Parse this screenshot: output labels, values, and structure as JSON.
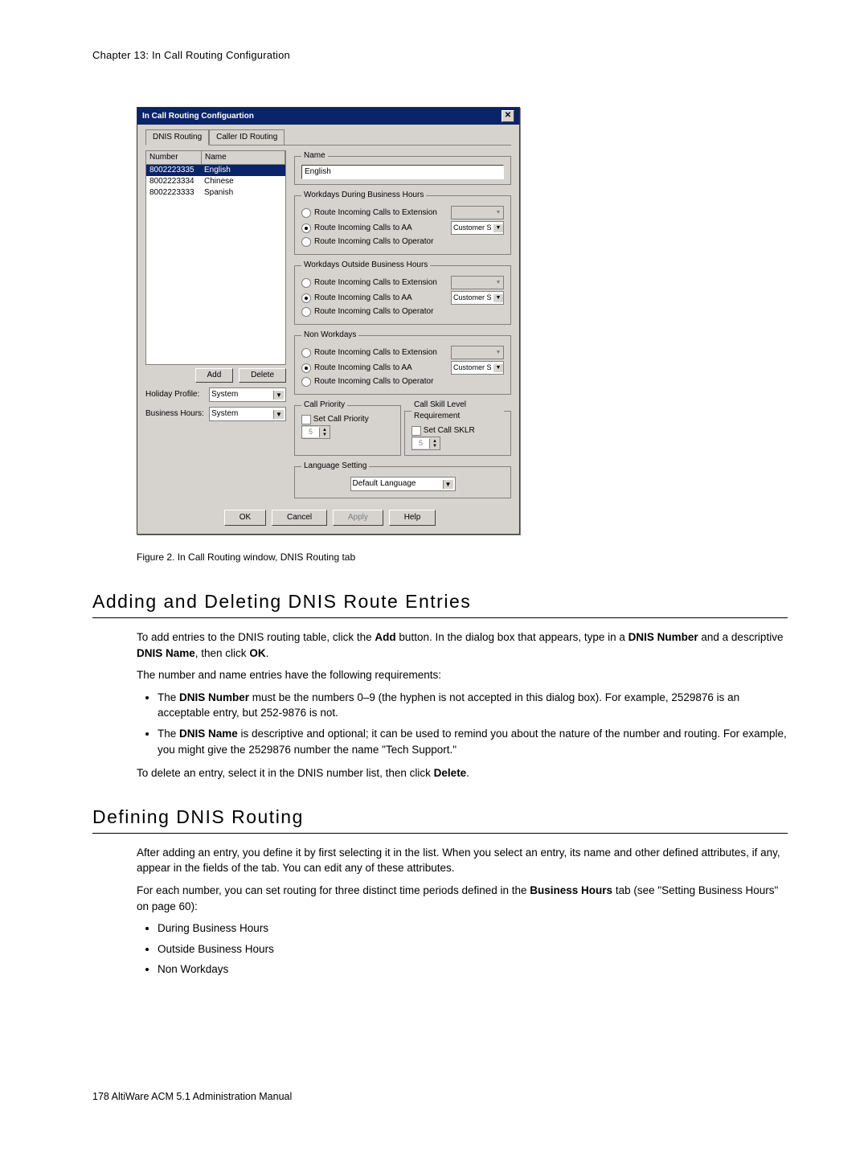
{
  "chapter": "Chapter 13:  In Call Routing Configuration",
  "dialog": {
    "title": "In Call Routing Configuartion",
    "close": "✕",
    "tabs": {
      "dnis": "DNIS Routing",
      "caller": "Caller ID Routing"
    },
    "table": {
      "headers": {
        "number": "Number",
        "name": "Name"
      },
      "rows": [
        {
          "num": "8002223335",
          "name": "English"
        },
        {
          "num": "8002223334",
          "name": "Chinese"
        },
        {
          "num": "8002223333",
          "name": "Spanish"
        }
      ]
    },
    "buttons": {
      "add": "Add",
      "delete": "Delete"
    },
    "holiday_label": "Holiday Profile:",
    "holiday_value": "System",
    "bh_label": "Business Hours:",
    "bh_value": "System",
    "name_legend": "Name",
    "name_value": "English",
    "groups": {
      "g1": "Workdays During Business Hours",
      "g2": "Workdays Outside Business Hours",
      "g3": "Non Workdays",
      "opt_ext": "Route Incoming Calls to Extension",
      "opt_aa": "Route Incoming Calls to AA",
      "opt_op": "Route Incoming Calls to Operator",
      "aa_sel": "Customer S"
    },
    "call_priority": {
      "legend": "Call Priority",
      "chk": "Set Call Priority",
      "val": "5"
    },
    "sklr": {
      "legend": "Call Skill Level Requirement",
      "chk": "Set Call SKLR",
      "val": "5"
    },
    "lang": {
      "legend": "Language Setting",
      "value": "Default Language"
    },
    "footer": {
      "ok": "OK",
      "cancel": "Cancel",
      "apply": "Apply",
      "help": "Help"
    }
  },
  "figure_caption": "Figure 2.   In Call Routing window, DNIS Routing tab",
  "section1": {
    "title": "Adding and Deleting DNIS Route Entries",
    "p1a": "To add entries to the DNIS routing table, click the ",
    "p1b": "Add",
    "p1c": " button. In the dialog box that appears, type in a ",
    "p1d": "DNIS Number",
    "p1e": " and a descriptive ",
    "p1f": "DNIS Name",
    "p1g": ", then click ",
    "p1h": "OK",
    "p1i": ".",
    "p2": "The number and name entries have the following requirements:",
    "li1a": "The ",
    "li1b": "DNIS Number",
    "li1c": " must be the numbers 0–9 (the hyphen is not accepted in this dialog box). For example, 2529876 is an acceptable entry, but 252-9876 is not.",
    "li2a": "The ",
    "li2b": "DNIS Name",
    "li2c": " is descriptive and optional; it can be used to remind you about the nature of the number and routing. For example, you might give the 2529876 number the name \"Tech Support.\"",
    "p3a": "To delete an entry, select it in the DNIS number list, then click ",
    "p3b": "Delete",
    "p3c": "."
  },
  "section2": {
    "title": "Defining DNIS Routing",
    "p1": "After adding an entry, you define it by first selecting it in the list. When you select an entry, its name and other defined attributes, if any, appear in the fields of the tab. You can edit any of these attributes.",
    "p2a": "For each number, you can set routing for three distinct time periods defined in the ",
    "p2b": "Business Hours",
    "p2c": " tab (see \"Setting Business Hours\" on page 60):",
    "li1": "During Business Hours",
    "li2": "Outside Business Hours",
    "li3": "Non Workdays"
  },
  "footer_text": "178   AltiWare ACM 5.1 Administration Manual"
}
